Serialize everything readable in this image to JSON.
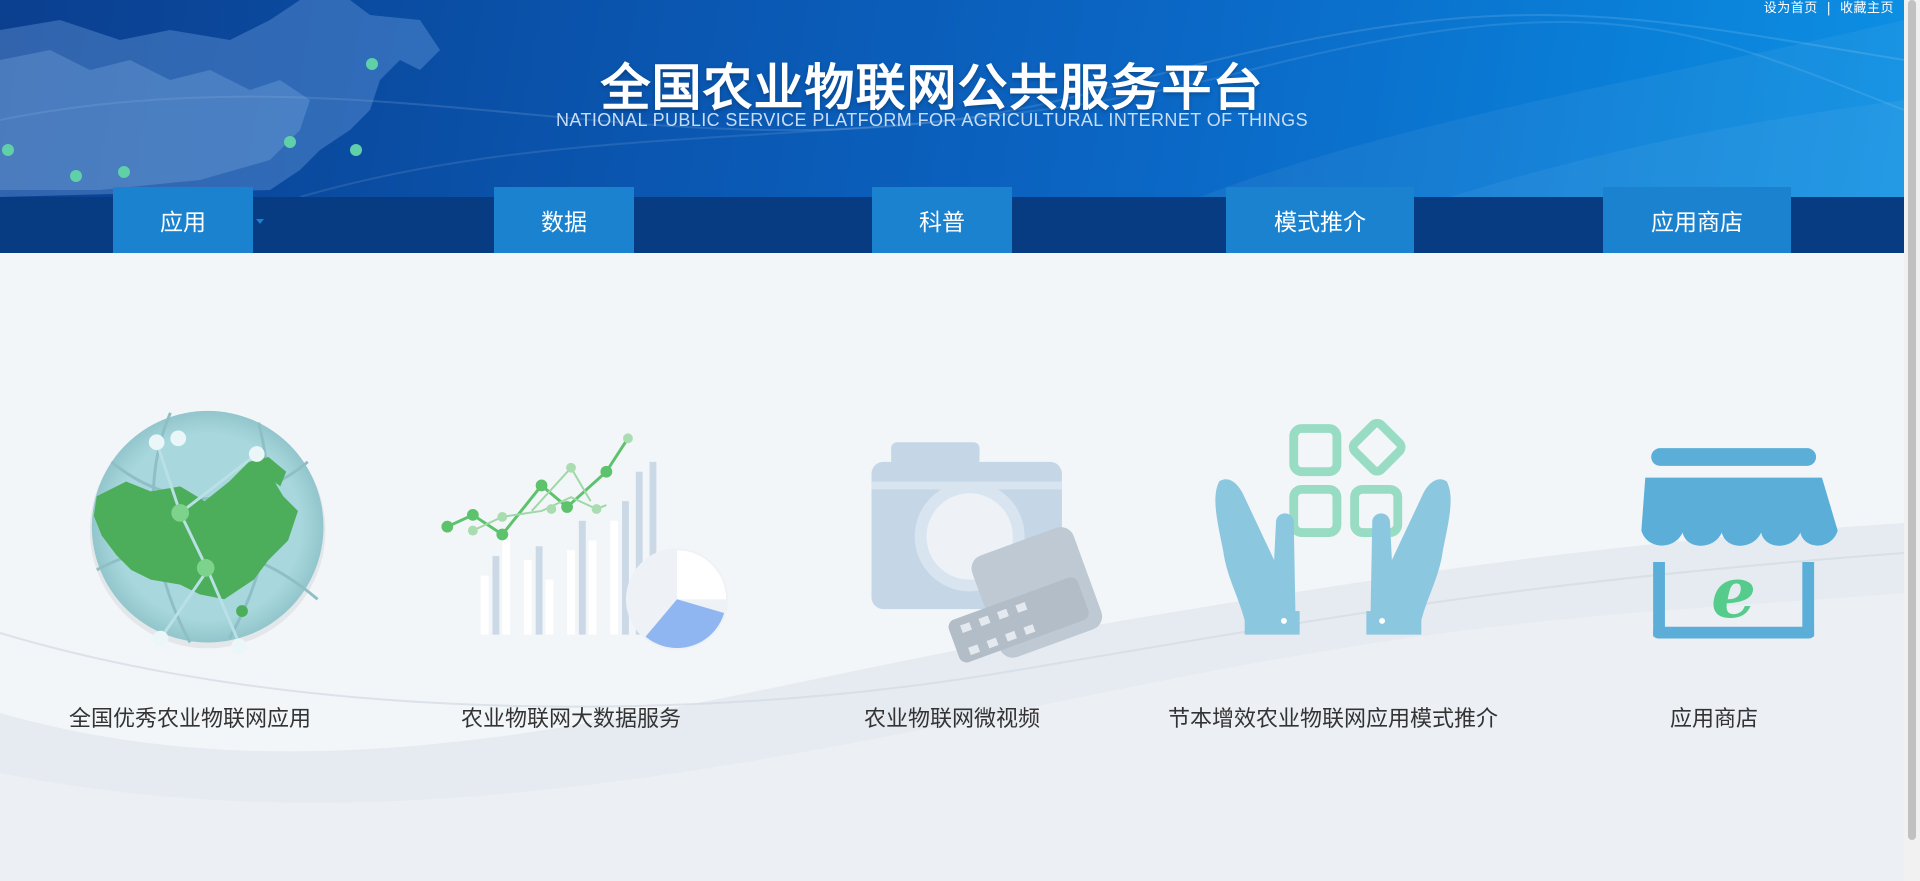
{
  "header": {
    "top_links": {
      "set_home": "设为首页",
      "separator": "|",
      "favorite": "收藏主页"
    },
    "title": "全国农业物联网公共服务平台",
    "subtitle": "NATIONAL PUBLIC SERVICE PLATFORM FOR AGRICULTURAL INTERNET OF THINGS"
  },
  "nav": {
    "tabs": [
      {
        "label": "应用"
      },
      {
        "label": "数据"
      },
      {
        "label": "科普"
      },
      {
        "label": "模式推介"
      },
      {
        "label": "应用商店"
      }
    ]
  },
  "cards": [
    {
      "label": "全国优秀农业物联网应用",
      "icon": "china-map-globe-icon"
    },
    {
      "label": "农业物联网大数据服务",
      "icon": "big-data-chart-icon"
    },
    {
      "label": "农业物联网微视频",
      "icon": "camera-film-icon"
    },
    {
      "label": "节本增效农业物联网应用模式推介",
      "icon": "hands-apps-icon"
    },
    {
      "label": "应用商店",
      "icon": "e-store-icon"
    }
  ],
  "colors": {
    "banner_dark": "#0b3f8f",
    "banner_light": "#0d90e3",
    "nav_bar": "#083c82",
    "nav_tab": "#1a82cf",
    "page_bg": "#f3f6f9",
    "label_text": "#333333"
  }
}
